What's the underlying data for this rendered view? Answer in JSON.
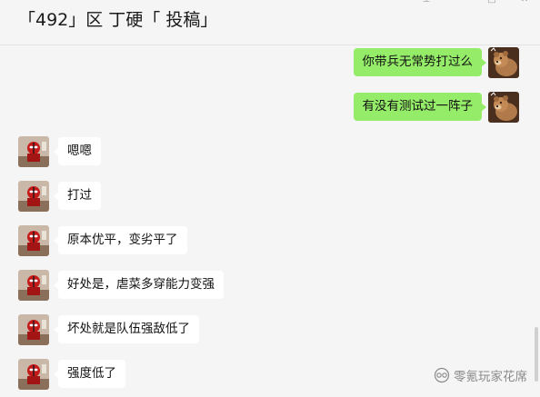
{
  "chat": {
    "title": "「492」区 丁硬「 投稿」"
  },
  "window_controls": {
    "pin_symbol": "⊥",
    "minimize_symbol": "—",
    "maximize_symbol": "□",
    "close_symbol": "✕"
  },
  "messages": [
    {
      "side": "out",
      "text": "你带兵无常势打过么"
    },
    {
      "side": "out",
      "text": "有没有测试过一阵子"
    },
    {
      "side": "in",
      "text": "嗯嗯"
    },
    {
      "side": "in",
      "text": "打过"
    },
    {
      "side": "in",
      "text": "原本优平，变劣平了"
    },
    {
      "side": "in",
      "text": "好处是，虐菜多穿能力变强"
    },
    {
      "side": "in",
      "text": "坏处就是队伍强敌低了"
    },
    {
      "side": "in",
      "text": "强度低了"
    }
  ],
  "watermark": {
    "text": "零氪玩家花席",
    "icon": "wechat-channel-icon"
  },
  "colors": {
    "outgoing_bubble": "#95ec69",
    "incoming_bubble": "#ffffff",
    "background": "#f5f5f5"
  }
}
